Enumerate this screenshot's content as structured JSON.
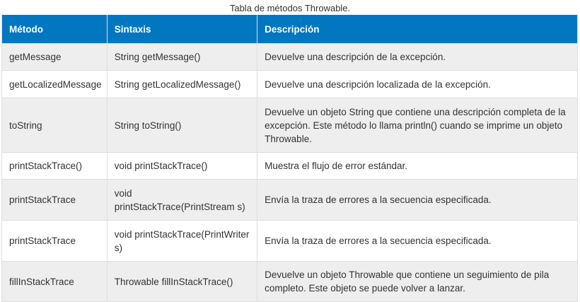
{
  "caption": "Tabla de métodos Throwable.",
  "table": {
    "headers": [
      "Método",
      "Sintaxis",
      "Descripción"
    ],
    "rows": [
      {
        "method": "getMessage",
        "syntax": "String getMessage()",
        "description": "Devuelve una descripción de la excepción."
      },
      {
        "method": "getLocalizedMessage",
        "syntax": "String getLocalizedMessage()",
        "description": "Devuelve una descripción localizada de la excepción."
      },
      {
        "method": "toString",
        "syntax": "String toString()",
        "description": "Devuelve un objeto String que contiene una descripción completa de la excepción. Este método lo llama println() cuando se imprime un objeto Throwable."
      },
      {
        "method": "printStackTrace()",
        "syntax": "void printStackTrace()",
        "description": "Muestra el flujo de error estándar."
      },
      {
        "method": "printStackTrace",
        "syntax": "void printStackTrace(PrintStream s)",
        "description": "Envía la traza de errores a la secuencia especificada."
      },
      {
        "method": "printStackTrace",
        "syntax": "void printStackTrace(PrintWriter s)",
        "description": "Envía la traza de errores a la secuencia especificada."
      },
      {
        "method": "fillInStackTrace",
        "syntax": "Throwable fillInStackTrace()",
        "description": "Devuelve un objeto Throwable que contiene un seguimiento de pila completo. Este objeto se puede volver a lanzar."
      }
    ]
  },
  "colors": {
    "header_bg": "#0077c0",
    "header_text": "#ffffff",
    "row_odd": "#eeeeee",
    "row_even": "#ffffff",
    "border": "#dddddd"
  }
}
